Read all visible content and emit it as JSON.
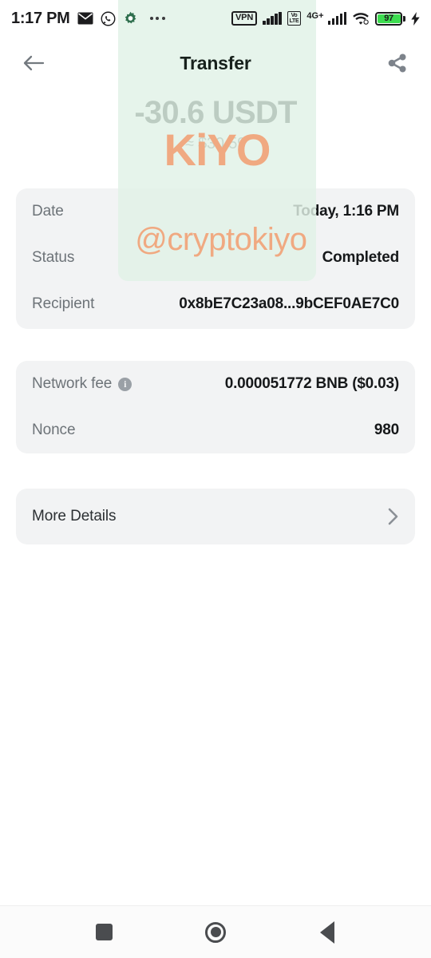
{
  "status_bar": {
    "time": "1:17 PM",
    "icons": [
      "mail-icon",
      "whatsapp-icon",
      "gear-icon",
      "overflow-dots-icon"
    ],
    "vpn_label": "VPN",
    "volte_line1": "Vo",
    "volte_line2": "LTE",
    "network_label": "4G+",
    "battery_percent": "97",
    "battery_color": "#3ddc50",
    "charging": true
  },
  "header": {
    "title": "Transfer",
    "back_icon": "arrow-left-icon",
    "share_icon": "share-icon"
  },
  "amount": {
    "primary": "-30.6 USDT",
    "secondary": "≈ $30.59"
  },
  "details_card": {
    "rows": [
      {
        "label": "Date",
        "value": "Today, 1:16 PM"
      },
      {
        "label": "Status",
        "value": "Completed"
      },
      {
        "label": "Recipient",
        "value": "0x8bE7C23a08...9bCEF0AE7C0"
      }
    ]
  },
  "fee_card": {
    "rows": [
      {
        "label": "Network fee",
        "value": "0.000051772 BNB ($0.03)",
        "has_info": true
      },
      {
        "label": "Nonce",
        "value": "980",
        "has_info": false
      }
    ]
  },
  "more_details": {
    "label": "More Details",
    "chevron_icon": "chevron-right-icon"
  },
  "watermark": {
    "brand": "KiYO",
    "handle": "@cryptokiyo",
    "color": "#f0a981",
    "panel_color": "#e0f1e7"
  },
  "nav_bar": {
    "recents": "square-recents-icon",
    "home": "circle-home-icon",
    "back": "triangle-back-icon"
  }
}
